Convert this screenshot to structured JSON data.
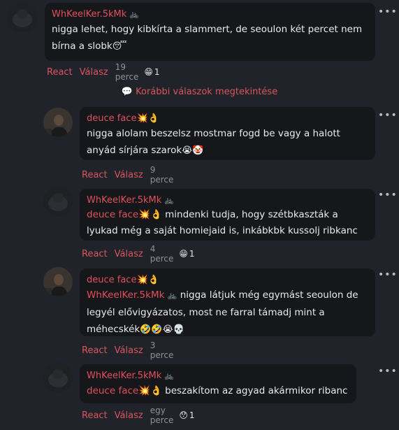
{
  "earlier_replies": "Korábbi válaszok megtekintése",
  "actions": {
    "react": "React",
    "reply": "Válasz"
  },
  "comments": [
    {
      "author": "WhKeelKer.5kMk",
      "text": "nigga lehet, hogy kibkírta a slammert, de seoulon két percet nem bírna a slobk",
      "emoji": "😴",
      "time": "19 perce",
      "reaction": "😁",
      "reaction_count": "1"
    },
    {
      "author": "deuce face💥👌",
      "text": "nigga alolam beszelsz mostmar fogd be vagy a halott anyád sírjára szarok",
      "emoji": "😭🤡",
      "time": "9 perce"
    },
    {
      "author": "WhKeelKer.5kMk",
      "mention": "deuce face💥👌",
      "text": "mindenki tudja, hogy szétbkaszták a lyukad még a saját homiejaid is, inkábkbk kussolj ribkanc",
      "time": "4 perce",
      "reaction": "😁",
      "reaction_count": "1"
    },
    {
      "author": "deuce face💥👌",
      "mention": "WhKeelKer.5kMk",
      "text": "nigga látjuk még egymást seoulon de legyél elővigyázatos, most ne farral támadj mint a méhecskék",
      "emoji": "🤣🤣😭💀",
      "time": "3 perce"
    },
    {
      "author": "WhKeelKer.5kMk",
      "mention": "deuce face💥👌",
      "text": "beszakítom az agyad akármikor ribanc",
      "time": "egy perce",
      "reaction": "😯",
      "reaction_count": "1"
    }
  ],
  "icons": {
    "more": "more-horizontal-icon",
    "bike": "bicycle-icon",
    "speech": "speech-bubble-icon"
  },
  "colors": {
    "background": "#202329",
    "bubble": "#15171b",
    "accent": "#e0515b",
    "muted": "#8e9199"
  }
}
